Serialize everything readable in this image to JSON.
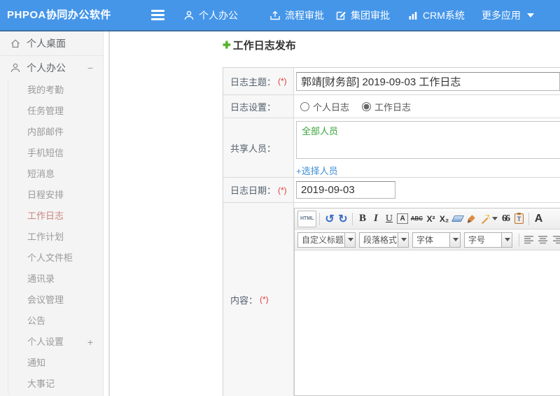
{
  "colors": {
    "header_bg": "#4596e9",
    "title_green": "#55b12c",
    "link_blue": "#3e8ed2",
    "sidebar_active_red": "#c9857f",
    "required_red": "#e23c39",
    "share_green": "#3aa33a"
  },
  "header": {
    "logo": "PHPOA协同办公软件",
    "nav": [
      {
        "label": "个人办公"
      },
      {
        "label": "流程审批"
      },
      {
        "label": "集团审批"
      },
      {
        "label": "CRM系统"
      },
      {
        "label": "更多应用"
      }
    ]
  },
  "sidebar": {
    "top_items": [
      {
        "label": "个人桌面"
      },
      {
        "label": "个人办公",
        "toggle": "−"
      }
    ],
    "sub_items": [
      "我的考勤",
      "任务管理",
      "内部邮件",
      "手机短信",
      "短消息",
      "日程安排",
      "工作日志",
      "工作计划",
      "个人文件柜",
      "通讯录",
      "会议管理",
      "公告",
      "个人设置",
      "通知",
      "大事记"
    ],
    "active_item": "工作日志",
    "settings_toggle": "+"
  },
  "main": {
    "title_icon": "✚",
    "page_title": "工作日志发布",
    "form": {
      "subject": {
        "label": "日志主题：",
        "required": "(*)",
        "value": "郭靖[财务部] 2019-09-03 工作日志"
      },
      "settings": {
        "label": "日志设置：",
        "options": [
          "个人日志",
          "工作日志"
        ],
        "selected": "工作日志"
      },
      "share": {
        "label": "共享人员：",
        "value": "全部人员",
        "link": "+选择人员"
      },
      "date": {
        "label": "日志日期：",
        "required": "(*)",
        "value": "2019-09-03"
      },
      "content": {
        "label": "内容：",
        "required": "(*)"
      },
      "editor": {
        "buttons": [
          {
            "name": "html-source",
            "glyph": "HTML"
          },
          {
            "name": "undo",
            "glyph": "↺"
          },
          {
            "name": "redo",
            "glyph": "↻"
          },
          {
            "name": "bold",
            "glyph": "B"
          },
          {
            "name": "italic",
            "glyph": "I"
          },
          {
            "name": "underline",
            "glyph": "U"
          },
          {
            "name": "font-border",
            "glyph": "A"
          },
          {
            "name": "strikethrough",
            "glyph": "ABC"
          },
          {
            "name": "superscript",
            "glyph": "X²"
          },
          {
            "name": "subscript",
            "glyph": "X₂"
          },
          {
            "name": "blockquote",
            "glyph": "66"
          },
          {
            "name": "paste-template",
            "glyph": "T"
          },
          {
            "name": "font-color",
            "glyph": "A"
          }
        ],
        "selects": [
          {
            "label": "自定义标题"
          },
          {
            "label": "段落格式"
          },
          {
            "label": "字体"
          },
          {
            "label": "字号"
          }
        ]
      }
    }
  }
}
